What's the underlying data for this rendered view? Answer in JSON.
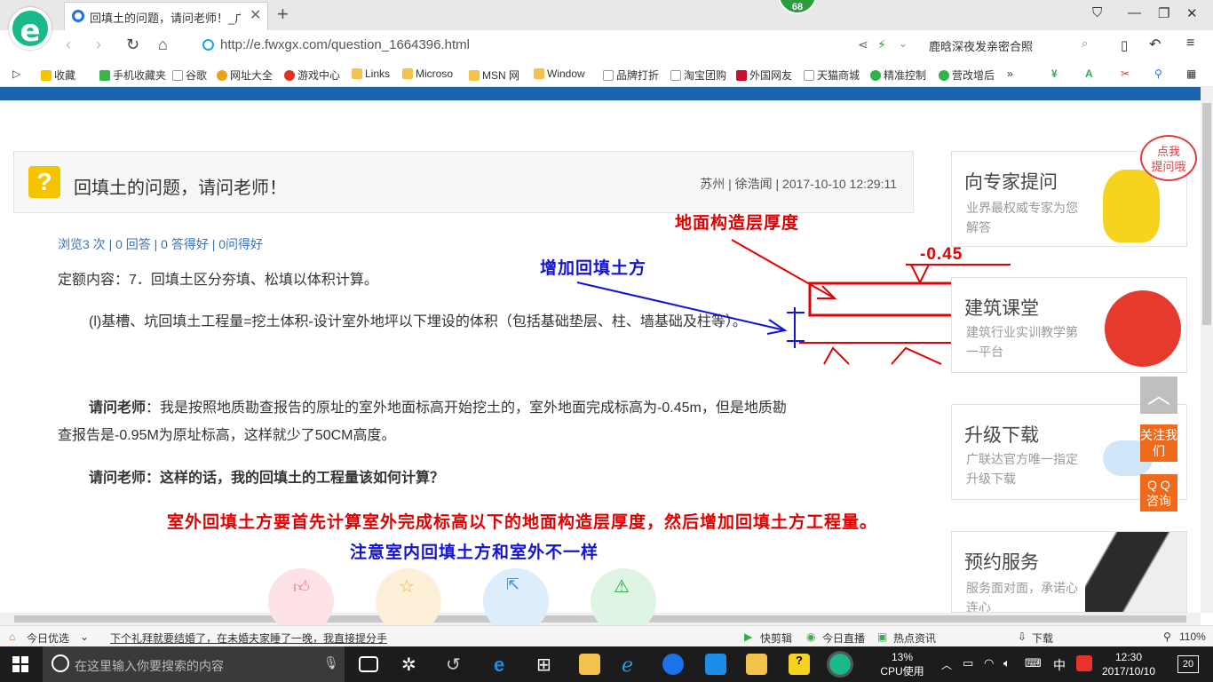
{
  "browser": {
    "tab_title": "回填土的问题，请问老师！_广联",
    "badge": "68",
    "url": "http://e.fwxgx.com/question_1664396.html",
    "search_text": "鹿晗深夜发亲密合照"
  },
  "bookmarks": [
    "收藏",
    "手机收藏夹",
    "谷歌",
    "网址大全",
    "游戏中心",
    "Links",
    "Microso",
    "MSN 网",
    "Window",
    "品牌打折",
    "淘宝团购",
    "外国网友",
    "天猫商城",
    "精准控制",
    "营改增后"
  ],
  "question": {
    "title": "回填土的问题，请问老师！",
    "meta": "苏州 | 徐浩闻 | 2017-10-10 12:29:11",
    "stats": "浏览3 次 | 0 回答 | 0 答得好 | 0问得好",
    "line1": "定额内容：7．回填土区分夯填、松填以体积计算。",
    "line2": "(l)基槽、坑回填土工程量=挖土体积-设计室外地坪以下埋设的体积（包括基础垫层、柱、墙基础及柱等）。",
    "q1_label": "请问老师",
    "q1_text": "：我是按照地质勘查报告的原址的室外地面标高开始挖土的，室外地面完成标高为-0.45m，但是地质勘",
    "q1_text2": "查报告是-0.95M为原址标高，这样就少了50CM高度。",
    "q2_label": "请问老师",
    "q2_text": "：这样的话，我的回填土的工程量该如何计算？"
  },
  "annotations": {
    "ground_layer": "地面构造层厚度",
    "add_fill": "增加回填土方",
    "level": "-0.45",
    "answer_red": "室外回填土方要首先计算室外完成标高以下的地面构造层厚度，然后增加回填土方工程量。",
    "answer_blue": "注意室内回填土方和室外不一样"
  },
  "sidebar": {
    "bubble": "点我\n提问哦",
    "cards": [
      {
        "title": "向专家提问",
        "sub": "业界最权威专家为您解答"
      },
      {
        "title": "建筑课堂",
        "sub": "建筑行业实训教学第一平台"
      },
      {
        "title": "升级下载",
        "sub": "广联达官方唯一指定升级下载"
      },
      {
        "title": "预约服务",
        "sub": "服务面对面，承诺心连心"
      }
    ],
    "follow": "关注我们",
    "qq": "Q Q 咨询"
  },
  "statusbar": {
    "left": "今日优选",
    "news": "下个礼拜就要结婚了，在未婚夫家睡了一晚，我直接提分手",
    "items": [
      "快剪辑",
      "今日直播",
      "热点资讯",
      "下载"
    ],
    "zoom": "110%"
  },
  "taskbar": {
    "search_placeholder": "在这里输入你要搜索的内容",
    "cpu": "13%",
    "cpu_label": "CPU使用",
    "ime": "中",
    "time": "12:30",
    "date": "2017/10/10",
    "notif": "20"
  },
  "colors": {
    "accent": "#1a63ae",
    "annotation_red": "#e30000",
    "annotation_blue": "#1313d8",
    "orange": "#f06a1c"
  }
}
